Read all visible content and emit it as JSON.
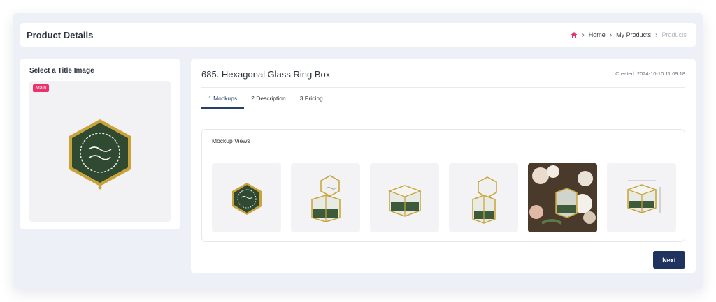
{
  "header": {
    "title": "Product Details",
    "breadcrumb": [
      "Home",
      "My Products",
      "Products"
    ]
  },
  "left": {
    "heading": "Select a Title Image",
    "badge": "Main"
  },
  "product": {
    "title": "685. Hexagonal Glass Ring Box",
    "created": "Created: 2024-10-10 11:09:18"
  },
  "tabs": [
    {
      "label": "1.Mockups",
      "active": true
    },
    {
      "label": "2.Description",
      "active": false
    },
    {
      "label": "3.Pricing",
      "active": false
    }
  ],
  "mockups": {
    "heading": "Mockup Views",
    "views": [
      "hex-box-top",
      "hex-box-open",
      "hex-box-side",
      "hex-box-open-angled",
      "hex-box-flowers-photo",
      "hex-box-dimensions"
    ]
  },
  "actions": {
    "next": "Next"
  },
  "colors": {
    "accent": "#203260",
    "badge": "#e8336b",
    "gold": "#c9a23a",
    "moss": "#3d5a3a"
  }
}
